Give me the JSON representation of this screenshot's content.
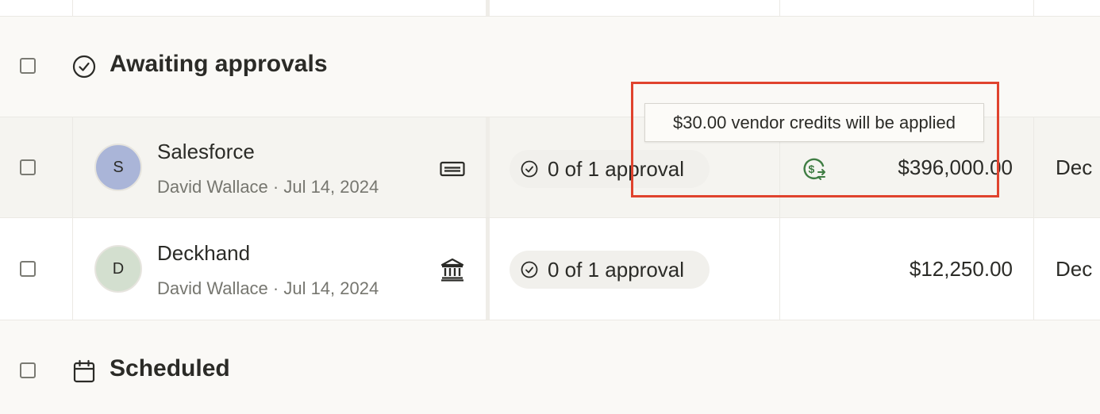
{
  "groups": {
    "awaiting": {
      "title": "Awaiting approvals"
    },
    "scheduled": {
      "title": "Scheduled"
    }
  },
  "rows": [
    {
      "avatar_letter": "S",
      "avatar_color": "#aab5d8",
      "vendor": "Salesforce",
      "sub": "David Wallace · Jul 14, 2024",
      "payment_icon": "card-icon",
      "approval": "0 of 1 approval",
      "credit_icon": "vendor-credit-icon",
      "amount": "$396,000.00",
      "due": "Dec"
    },
    {
      "avatar_letter": "D",
      "avatar_color": "#d3dfcf",
      "vendor": "Deckhand",
      "sub": "David Wallace · Jul 14, 2024",
      "payment_icon": "bank-icon",
      "approval": "0 of 1 approval",
      "amount": "$12,250.00",
      "due": "Dec"
    }
  ],
  "tooltip": {
    "text": "$30.00 vendor credits will be applied"
  },
  "colors": {
    "highlight": "#e0432e",
    "credit_icon": "#3f7d43",
    "section_bg": "#faf9f6",
    "hover_row_bg": "#f5f4f0"
  }
}
